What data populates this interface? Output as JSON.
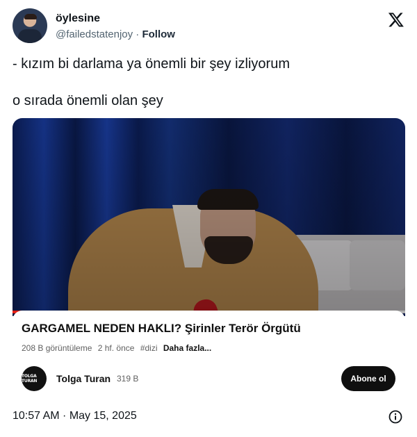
{
  "author": {
    "display_name": "öylesine",
    "handle": "@failedstatenjoy",
    "separator": "·",
    "follow_label": "Follow"
  },
  "tweet": {
    "line1": "- kızım bi darlama ya önemli bir şey izliyorum",
    "line2": "o sırada önemli olan şey"
  },
  "video": {
    "title": "GARGAMEL NEDEN HAKLI? Şirinler Terör Örgütü",
    "views": "208 B görüntüleme",
    "age": "2 hf. önce",
    "tag": "#dizi",
    "more": "Daha fazla...",
    "progress": 0.14
  },
  "channel": {
    "logo_text": "TOLGA TURAN",
    "name": "Tolga Turan",
    "subscribers": "319 B",
    "subscribe_label": "Abone ol"
  },
  "footer": {
    "timestamp": "10:57 AM · May 15, 2025"
  },
  "colors": {
    "progress": "#e62117",
    "text": "#0f1419",
    "muted": "#536471"
  },
  "icons": {
    "brand": "x-logo-icon",
    "info": "info-icon"
  }
}
